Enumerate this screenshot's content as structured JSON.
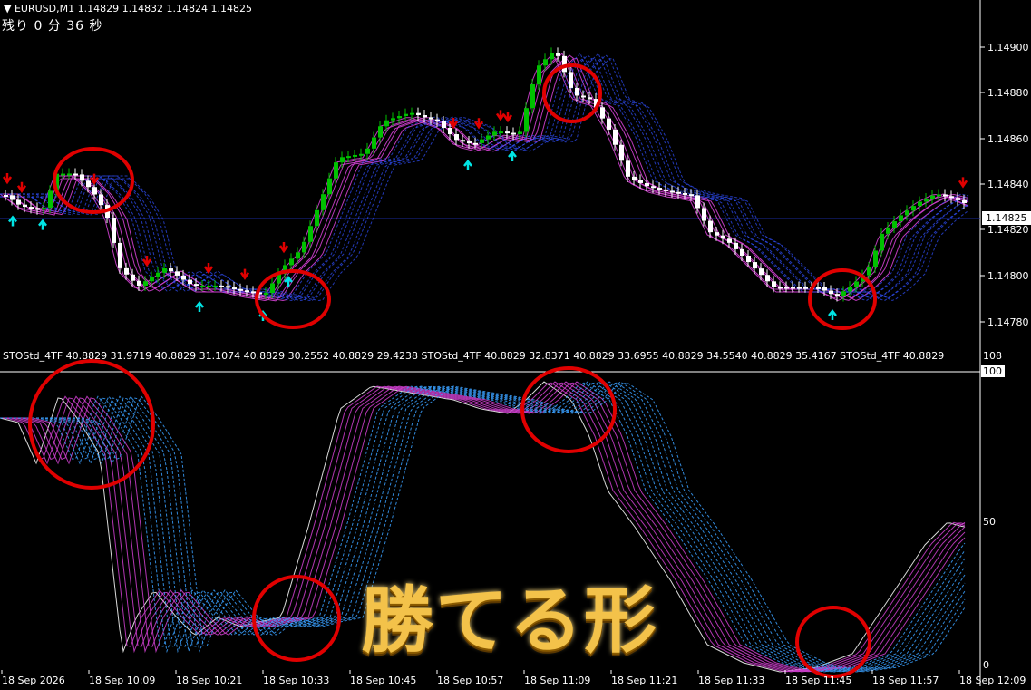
{
  "header": {
    "symbol_line": "▼ EURUSD,M1  1.14829 1.14832 1.14824 1.14825",
    "countdown": "残り 0 分 36 秒"
  },
  "price_axis": {
    "labels": [
      "1.14900",
      "1.14880",
      "1.14860",
      "1.14840",
      "1.14820",
      "1.14800",
      "1.14780"
    ],
    "current_price": "1.14825"
  },
  "indicator": {
    "label": "STOStd_4TF 40.8829 31.9719 40.8829 31.1074 40.8829 30.2552 40.8829 29.4238   STOStd_4TF 40.8829 32.8371 40.8829 33.6955 40.8829 34.5540 40.8829 35.4167   STOStd_4TF 40.8829",
    "axis_labels": [
      "108",
      "100",
      "50",
      "0"
    ]
  },
  "time_axis": {
    "labels": [
      "18 Sep 2026",
      "18 Sep 10:09",
      "18 Sep 10:21",
      "18 Sep 10:33",
      "18 Sep 10:45",
      "18 Sep 10:57",
      "18 Sep 11:09",
      "18 Sep 11:21",
      "18 Sep 11:33",
      "18 Sep 11:45",
      "18 Sep 11:57",
      "18 Sep 12:09"
    ]
  },
  "banner": {
    "text": "勝てる形"
  },
  "colors": {
    "background": "#000000",
    "bull_candle": "#00c000",
    "bear_candle": "#ffffff",
    "up_arrow": "#00e5e5",
    "down_arrow": "#e00000",
    "ma_magenta": "#d040d0",
    "ma_blue": "#3050ff",
    "highlight_circle": "#e00000"
  }
}
